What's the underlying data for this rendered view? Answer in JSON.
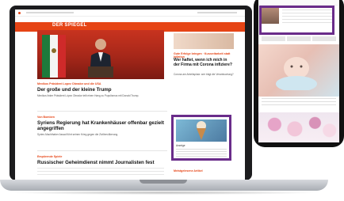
{
  "site": {
    "brand": "DER SPIEGEL"
  },
  "articles": [
    {
      "kicker": "Mexikos Präsident Lopez Obrador und die USA",
      "headline": "Der große und der kleine Trump",
      "body": "Mexikos linker Präsident López Obrador teilt einen Hang zu Populismus mit Donald Trump."
    },
    {
      "kicker": "Von Bomben",
      "headline": "Syriens Regierung hat Krankenhäuser offenbar gezielt angegriffen",
      "body": "Syrien-Machthaber Assad führt seinen Krieg gegen die Zivilbevölkerung."
    },
    {
      "kicker": "Empörende Spiele",
      "headline": "Russischer Geheimdienst nimmt Journalisten fest",
      "body": ""
    }
  ],
  "side": {
    "kicker": "Gute Erfolge bringen · Kurzzeitarbeit statt Inflation",
    "headline": "Wer haftet, wenn ich mich in der Firma mit Corona infiziere?",
    "body": "Corona am Arbeitsplatz: wer trägt die Verantwortung?"
  },
  "promo": {
    "label": "Anzeige"
  },
  "section_label": "Meistgelesene Artikel",
  "colors": {
    "brand_red": "#e64415",
    "highlight_purple": "#6a2c8a"
  }
}
